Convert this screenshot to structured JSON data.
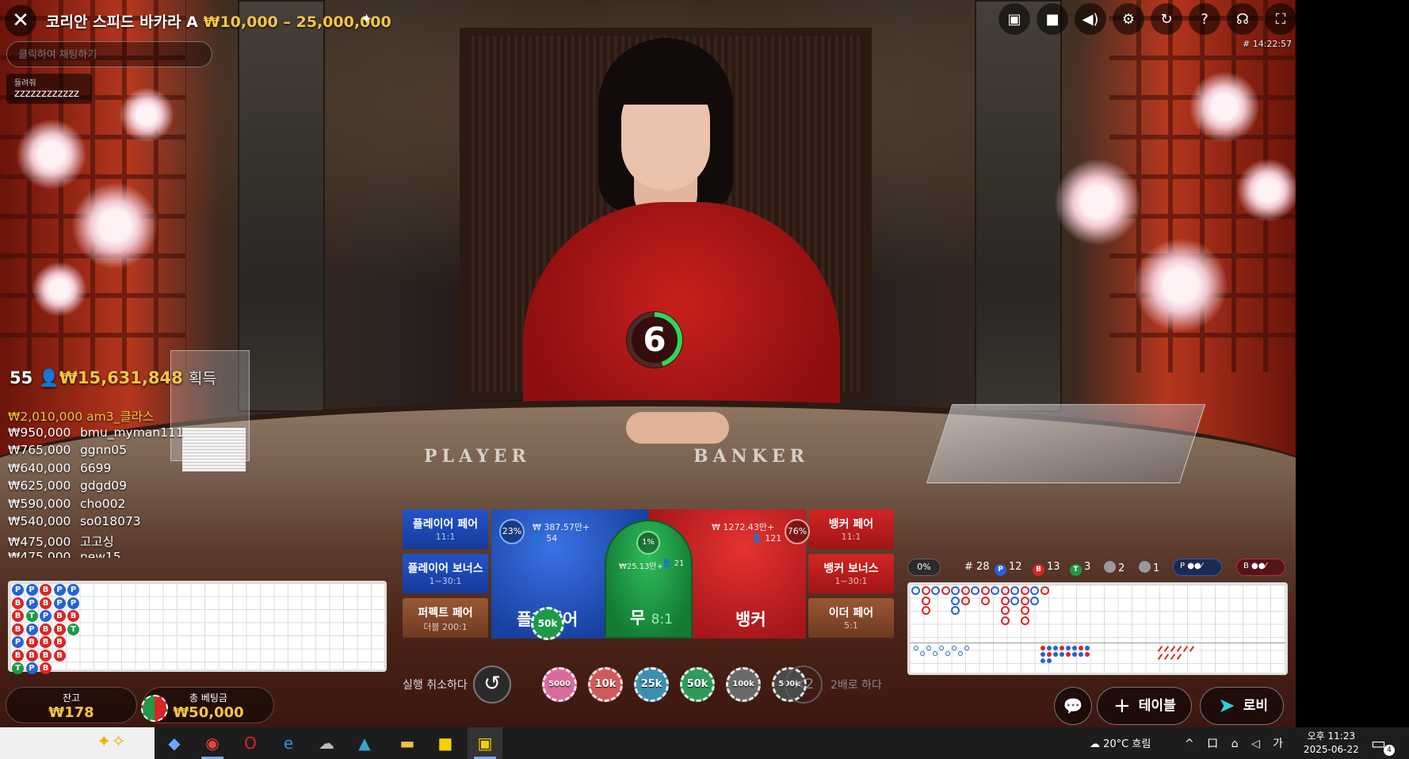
{
  "header": {
    "close_icon": "✕",
    "title": "코리안 스피드 바카라 A",
    "limit": "₩10,000 – 25,000,000",
    "round_id": "# 14:22:57",
    "icons": [
      "chat-icon",
      "video-icon",
      "volume-icon",
      "settings-icon",
      "history-icon",
      "help-icon",
      "headset-icon",
      "fullscreen-icon"
    ]
  },
  "chat": {
    "placeholder": "클릭하여 채팅하기",
    "message_user": "들려줘",
    "message_text": "zzzzzzzzzzzz"
  },
  "timer": {
    "value": "6",
    "fraction_remaining": 0.45
  },
  "table_text": {
    "player": "PLAYER",
    "banker": "BANKER"
  },
  "winners": {
    "count": "55",
    "total": "₩15,631,848",
    "label": "획득",
    "list": [
      {
        "amount": "₩2,010,000",
        "name": "am3_클라스"
      },
      {
        "amount": "₩950,000",
        "name": "bmu_myman111"
      },
      {
        "amount": "₩765,000",
        "name": "ggnn05"
      },
      {
        "amount": "₩640,000",
        "name": "6699"
      },
      {
        "amount": "₩625,000",
        "name": "gdgd09"
      },
      {
        "amount": "₩590,000",
        "name": "cho002"
      },
      {
        "amount": "₩540,000",
        "name": "so018073"
      },
      {
        "amount": "₩475,000",
        "name": "고고싱"
      },
      {
        "amount": "₩475,000",
        "name": "new15"
      }
    ]
  },
  "bead_road": [
    [
      "P",
      "B",
      "B",
      "B",
      "P",
      "B",
      "T"
    ],
    [
      "P",
      "P",
      "T",
      "P",
      "B",
      "B",
      "P"
    ],
    [
      "B",
      "B",
      "P",
      "B",
      "B",
      "B",
      "B"
    ],
    [
      "P",
      "P",
      "B",
      "B",
      "B",
      "B"
    ],
    [
      "P",
      "P",
      "B",
      "T"
    ]
  ],
  "side_bets": {
    "player_pair": {
      "label": "플레이어 페어",
      "odds": "11:1"
    },
    "player_bonus": {
      "label": "플레이어 보너스",
      "odds": "1~30:1"
    },
    "perfect_pair": {
      "label": "퍼펙트 페어",
      "odds": "더블 200:1"
    },
    "banker_pair": {
      "label": "뱅커 페어",
      "odds": "11:1"
    },
    "banker_bonus": {
      "label": "뱅커 보너스",
      "odds": "1~30:1"
    },
    "either_pair": {
      "label": "이더 페어",
      "odds": "5:1"
    }
  },
  "main_bets": {
    "player": {
      "label": "플레이어",
      "percent": "23%",
      "amount": "₩ 387.57만+",
      "players": "54",
      "chip": "50k"
    },
    "tie": {
      "label": "무",
      "odds": "8:1",
      "percent": "1%",
      "amount": "₩25.13만+",
      "players": "21"
    },
    "banker": {
      "label": "뱅커",
      "percent": "76%",
      "amount": "₩ 1272.43만+",
      "players": "121"
    }
  },
  "controls": {
    "undo_label": "실행 취소하다",
    "undo_icon": "↺",
    "chips": [
      {
        "label": "5000",
        "color": "#d86b9a"
      },
      {
        "label": "10k",
        "color": "#d05a5a"
      },
      {
        "label": "25k",
        "color": "#3d8fb0"
      },
      {
        "label": "50k",
        "color": "#2f9a5a"
      },
      {
        "label": "100k",
        "color": "#6a6a6a"
      },
      {
        "label": "500k",
        "color": "#4a4a4a"
      }
    ],
    "double_icon": "×2",
    "double_label": "2배로 하다"
  },
  "balance": {
    "label": "잔고",
    "value": "₩178"
  },
  "total_bet": {
    "label": "총 베팅금",
    "value": "₩50,000"
  },
  "stats": {
    "percent": "0%",
    "round": "# 28",
    "player": "12",
    "banker": "13",
    "tie": "3",
    "player_pair": "2",
    "banker_pair": "1",
    "p_predict": "P",
    "b_predict": "B"
  },
  "nav": {
    "table_label": "테이블",
    "lobby_label": "로비"
  },
  "taskbar": {
    "weather": "20°C  흐림",
    "tray": "^ 口 ⌂ ◁ 가",
    "time": "오후 11:23",
    "date": "2025-06-22",
    "badge": "4"
  }
}
